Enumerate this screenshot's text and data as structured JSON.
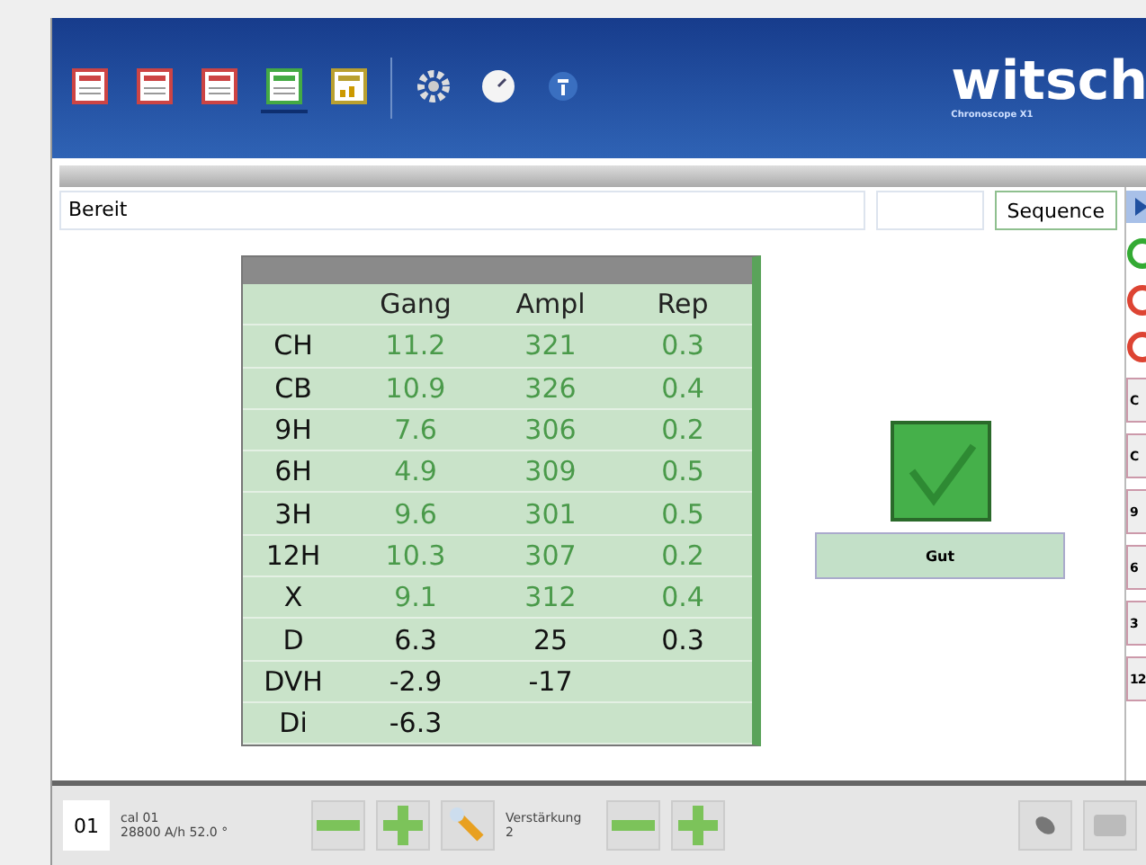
{
  "toolbar": {
    "icons": [
      {
        "kind": "doc-red"
      },
      {
        "kind": "doc-red"
      },
      {
        "kind": "doc-red"
      },
      {
        "kind": "doc-green",
        "selected": true
      },
      {
        "kind": "doc-chart"
      },
      {
        "kind": "gear"
      },
      {
        "kind": "clock"
      },
      {
        "kind": "info"
      }
    ],
    "logo": "witsch",
    "logo_sub": "Chronoscope X1"
  },
  "status": {
    "message": "Bereit",
    "button": "Sequence"
  },
  "table": {
    "columns": [
      "Gang",
      "Ampl",
      "Rep"
    ],
    "rows": [
      {
        "label": "CH",
        "kind": "measured",
        "values": [
          "11.2",
          "321",
          "0.3"
        ]
      },
      {
        "label": "CB",
        "kind": "measured",
        "values": [
          "10.9",
          "326",
          "0.4"
        ]
      },
      {
        "label": "9H",
        "kind": "measured",
        "values": [
          "7.6",
          "306",
          "0.2"
        ]
      },
      {
        "label": "6H",
        "kind": "measured",
        "values": [
          "4.9",
          "309",
          "0.5"
        ]
      },
      {
        "label": "3H",
        "kind": "measured",
        "values": [
          "9.6",
          "301",
          "0.5"
        ]
      },
      {
        "label": "12H",
        "kind": "measured",
        "values": [
          "10.3",
          "307",
          "0.2"
        ]
      },
      {
        "label": "X",
        "kind": "measured",
        "values": [
          "9.1",
          "312",
          "0.4"
        ]
      },
      {
        "label": "D",
        "kind": "result",
        "values": [
          "6.3",
          "25",
          "0.3"
        ]
      },
      {
        "label": "DVH",
        "kind": "result",
        "values": [
          "-2.9",
          "-17"
        ]
      },
      {
        "label": "Di",
        "kind": "result",
        "values": [
          "-6.3"
        ]
      }
    ]
  },
  "verdict": {
    "ok": true,
    "label": "Gut"
  },
  "side_buttons": [
    {
      "kind": "play"
    },
    {
      "kind": "green"
    },
    {
      "kind": "red"
    },
    {
      "kind": "red"
    },
    {
      "kind": "text",
      "label": "C"
    },
    {
      "kind": "text",
      "label": "C"
    },
    {
      "kind": "text",
      "label": "9"
    },
    {
      "kind": "text",
      "label": "6"
    },
    {
      "kind": "text",
      "label": "3"
    },
    {
      "kind": "text",
      "label": "12"
    }
  ],
  "bottom": {
    "number": "01",
    "calibration": "cal 01",
    "settings": "28800 A/h  52.0 °",
    "gain_label": "Verstärkung",
    "gain_value": "2"
  }
}
